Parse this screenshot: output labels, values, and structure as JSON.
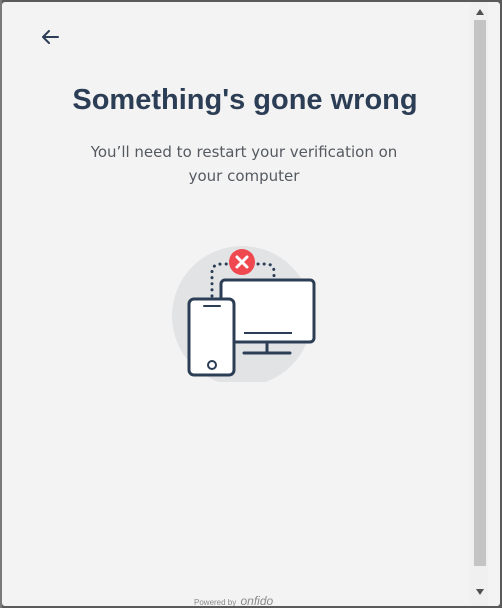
{
  "dialog": {
    "back_icon": "arrow-left-icon",
    "title": "Something's gone wrong",
    "subtitle": "You’ll need to restart your verification on your computer",
    "illustration_icon": "phone-computer-error-icon",
    "powered_by": "Powered by",
    "brand": "onfido"
  },
  "colors": {
    "background": "#f3f3f3",
    "title": "#2c3e55",
    "subtitle": "#555a61",
    "error": "#f0484f",
    "device_stroke": "#2c3e55",
    "circle": "#e2e3e5"
  }
}
